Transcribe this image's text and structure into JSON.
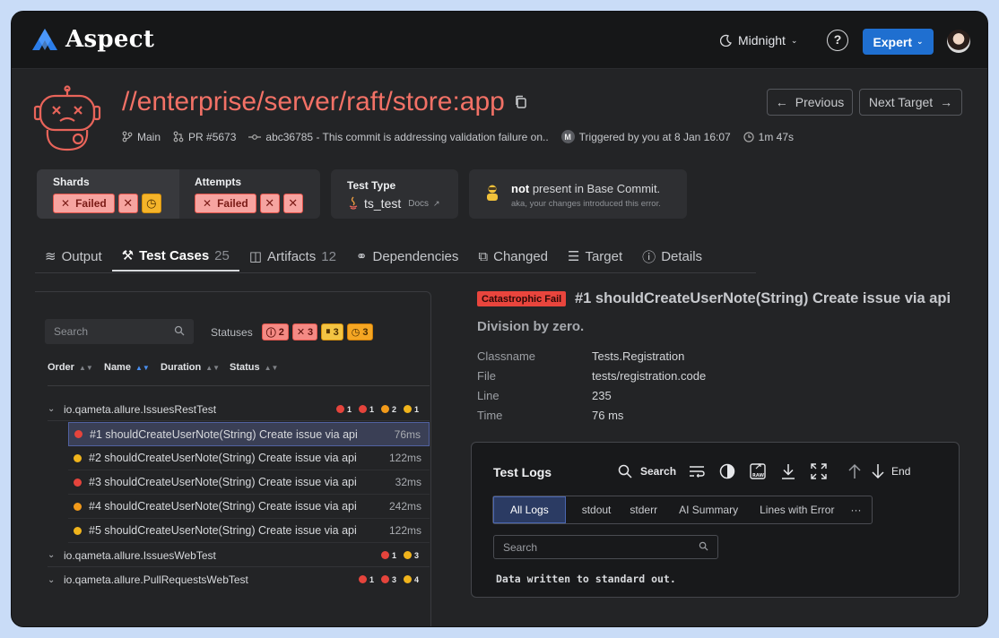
{
  "app": {
    "name": "Aspect",
    "theme_label": "Midnight",
    "help_label": "?",
    "mode_label": "Expert"
  },
  "target": {
    "title": "//enterprise/server/raft/store:app"
  },
  "meta": {
    "branch": "Main",
    "pr": "PR #5673",
    "commit": "abc36785 - This commit is addressing validation failure on..",
    "trigger_initial": "M",
    "triggered": "Triggered by you at 8 Jan 16:07",
    "duration": "1m 47s"
  },
  "nav": {
    "previous": "Previous",
    "next": "Next Target"
  },
  "cards": {
    "shards_label": "Shards",
    "attempts_label": "Attempts",
    "failed_label": "Failed",
    "test_type_label": "Test Type",
    "test_type_value": "ts_test",
    "docs_label": "Docs",
    "base_strong": "not",
    "base_rest": " present in Base Commit.",
    "base_sub": "aka, your changes introduced this error."
  },
  "tabs": [
    {
      "label": "Output",
      "count": ""
    },
    {
      "label": "Test Cases",
      "count": "25"
    },
    {
      "label": "Artifacts",
      "count": "12"
    },
    {
      "label": "Dependencies",
      "count": ""
    },
    {
      "label": "Changed",
      "count": ""
    },
    {
      "label": "Target",
      "count": ""
    },
    {
      "label": "Details",
      "count": ""
    }
  ],
  "tests": {
    "search_placeholder": "Search",
    "statuses_label": "Statuses",
    "status_counts": [
      "2",
      "3",
      "3",
      "3"
    ],
    "columns": [
      "Order",
      "Name",
      "Duration",
      "Status"
    ],
    "groups": [
      {
        "name": "io.qameta.allure.IssuesRestTest",
        "counts": [
          "1",
          "1",
          "2",
          "1"
        ]
      },
      {
        "name": "io.qameta.allure.IssuesWebTest",
        "counts": [
          "1",
          "3"
        ]
      },
      {
        "name": "io.qameta.allure.PullRequestsWebTest",
        "counts": [
          "1",
          "3",
          "4"
        ]
      }
    ],
    "rows": [
      {
        "name": "#1 shouldCreateUserNote(String) Create issue via api",
        "duration": "76ms",
        "status_color": "#e5443c"
      },
      {
        "name": "#2 shouldCreateUserNote(String) Create issue via api",
        "duration": "122ms",
        "status_color": "#f0b41c"
      },
      {
        "name": "#3 shouldCreateUserNote(String) Create issue via api",
        "duration": "32ms",
        "status_color": "#e5443c"
      },
      {
        "name": "#4 shouldCreateUserNote(String) Create issue via api",
        "duration": "242ms",
        "status_color": "#f29a1a"
      },
      {
        "name": "#5 shouldCreateUserNote(String) Create issue via api",
        "duration": "122ms",
        "status_color": "#f0b41c"
      }
    ]
  },
  "detail": {
    "badge": "Catastrophic Fail",
    "title": "#1 shouldCreateUserNote(String) Create issue via api",
    "error": "Division by zero.",
    "fields": [
      {
        "key": "Classname",
        "value": "Tests.Registration"
      },
      {
        "key": "File",
        "value": "tests/registration.code"
      },
      {
        "key": "Line",
        "value": "235"
      },
      {
        "key": "Time",
        "value": "76 ms"
      }
    ]
  },
  "logs": {
    "title": "Test Logs",
    "search_label": "Search",
    "end_label": "End",
    "tabs": [
      "All Logs",
      "stdout",
      "stderr",
      "AI Summary",
      "Lines with Error",
      "···"
    ],
    "search_placeholder": "Search",
    "output": "Data written to standard out."
  },
  "colors": {
    "accent": "#1f6fd0",
    "fail": "#e5443c",
    "title": "#f27166",
    "warn": "#f0b41c"
  }
}
